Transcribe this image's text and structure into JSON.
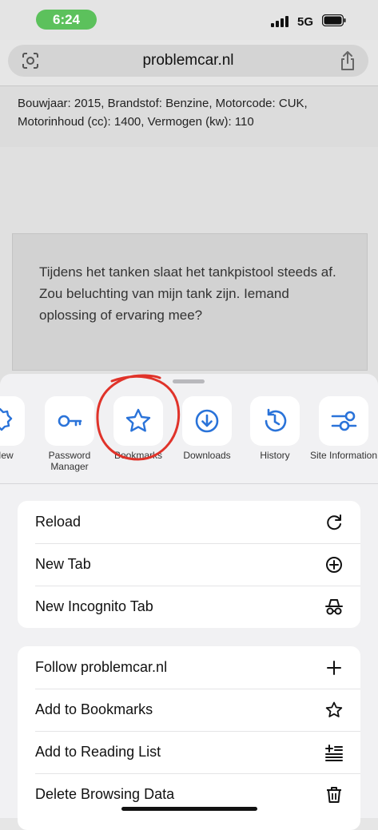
{
  "status_bar": {
    "time": "6:24",
    "network": "5G"
  },
  "address_bar": {
    "url": "problemcar.nl"
  },
  "page": {
    "specs": "Bouwjaar: 2015, Brandstof: Benzine, Motorcode: CUK, Motorinhoud (cc): 1400, Vermogen (kw): 110",
    "post_text": "Tijdens het tanken slaat het tankpistool steeds af. Zou beluchting van mijn tank zijn. Iemand oplossing of ervaring mee?"
  },
  "actions": [
    {
      "label": "s New",
      "icon": "whats-new-icon"
    },
    {
      "label": "Password Manager",
      "icon": "key-icon"
    },
    {
      "label": "Bookmarks",
      "icon": "star-icon"
    },
    {
      "label": "Downloads",
      "icon": "download-icon"
    },
    {
      "label": "History",
      "icon": "history-icon"
    },
    {
      "label": "Site Information",
      "icon": "site-information-icon"
    }
  ],
  "menu_group_1": [
    {
      "label": "Reload",
      "icon": "reload-icon"
    },
    {
      "label": "New Tab",
      "icon": "plus-circle-icon"
    },
    {
      "label": "New Incognito Tab",
      "icon": "incognito-icon"
    }
  ],
  "menu_group_2": [
    {
      "label": "Follow problemcar.nl",
      "icon": "plus-icon"
    },
    {
      "label": "Add to Bookmarks",
      "icon": "star-outline-icon"
    },
    {
      "label": "Add to Reading List",
      "icon": "reading-list-icon"
    },
    {
      "label": "Delete Browsing Data",
      "icon": "trash-icon"
    }
  ],
  "colors": {
    "accent": "#2a73d9",
    "annotation": "#e0332a",
    "time_pill": "#5cc15c"
  }
}
